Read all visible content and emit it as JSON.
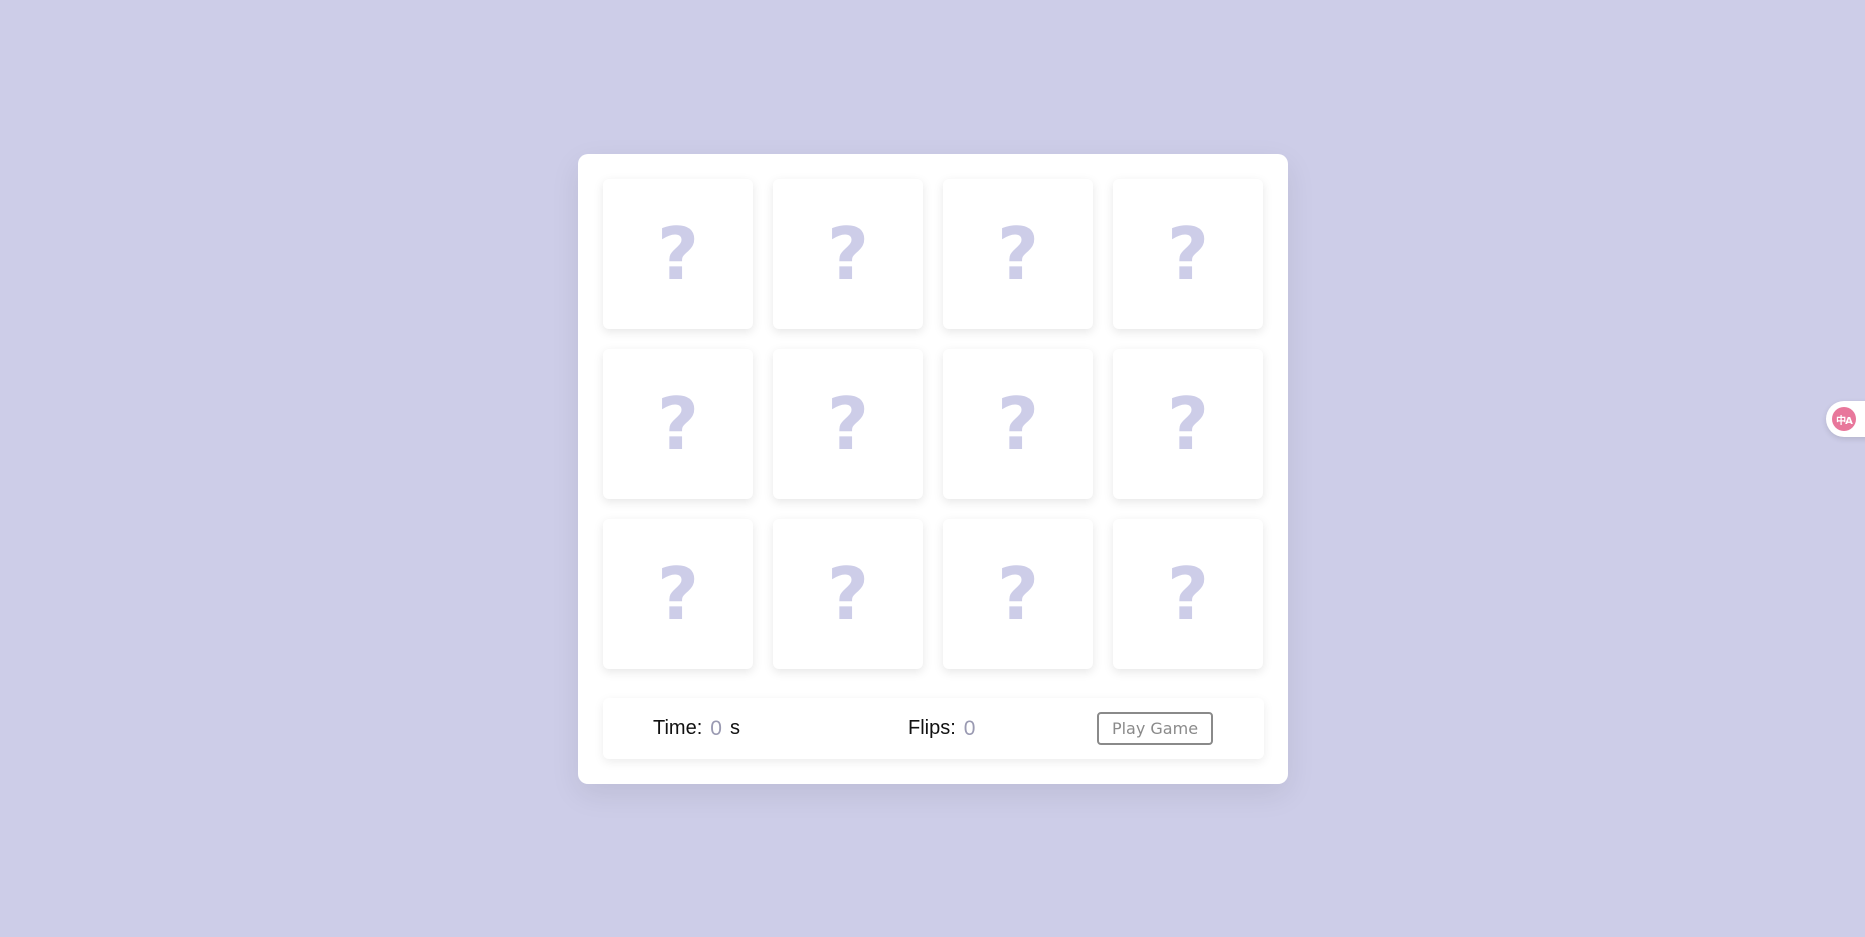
{
  "game": {
    "cards": [
      {
        "face": "?"
      },
      {
        "face": "?"
      },
      {
        "face": "?"
      },
      {
        "face": "?"
      },
      {
        "face": "?"
      },
      {
        "face": "?"
      },
      {
        "face": "?"
      },
      {
        "face": "?"
      },
      {
        "face": "?"
      },
      {
        "face": "?"
      },
      {
        "face": "?"
      },
      {
        "face": "?"
      }
    ],
    "stats": {
      "time_label": "Time:",
      "time_value": "0",
      "time_unit": "s",
      "flips_label": "Flips:",
      "flips_value": "0"
    },
    "play_button_label": "Play Game"
  },
  "translate_widget": {
    "icon": "translate-icon",
    "glyph": "中A"
  },
  "colors": {
    "background": "#cdcde8",
    "question_mark": "#cdcde8",
    "stat_value": "#9a9ab2",
    "translate_accent": "#e8779b"
  }
}
